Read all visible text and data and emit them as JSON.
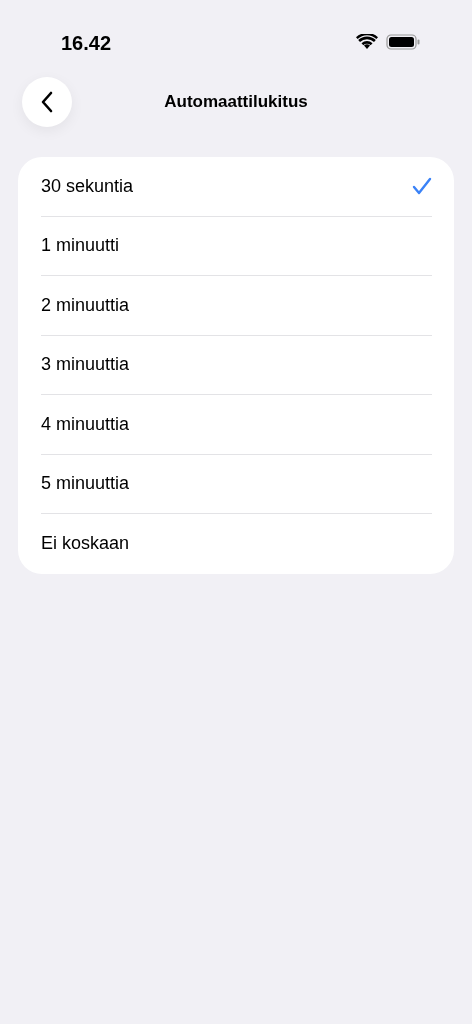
{
  "status_bar": {
    "time": "16.42"
  },
  "header": {
    "title": "Automaattilukitus"
  },
  "options": [
    {
      "label": "30 sekuntia",
      "selected": true
    },
    {
      "label": "1 minuutti",
      "selected": false
    },
    {
      "label": "2 minuuttia",
      "selected": false
    },
    {
      "label": "3 minuuttia",
      "selected": false
    },
    {
      "label": "4 minuuttia",
      "selected": false
    },
    {
      "label": "5 minuuttia",
      "selected": false
    },
    {
      "label": "Ei koskaan",
      "selected": false
    }
  ]
}
